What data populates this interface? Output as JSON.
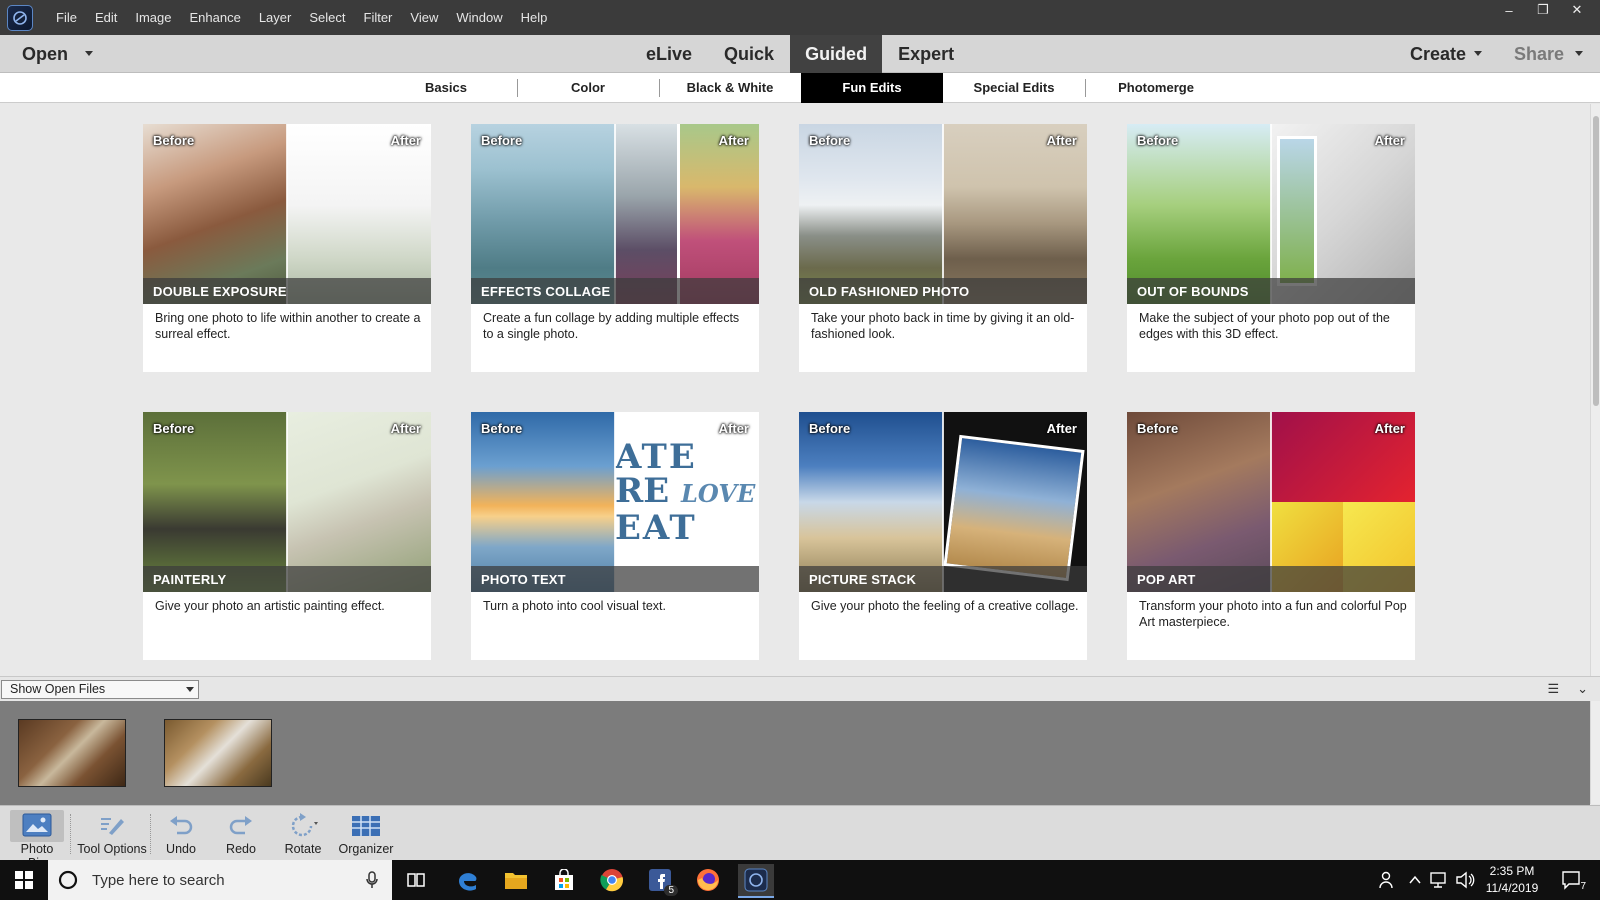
{
  "menu": [
    "File",
    "Edit",
    "Image",
    "Enhance",
    "Layer",
    "Select",
    "Filter",
    "View",
    "Window",
    "Help"
  ],
  "window_controls": {
    "minimize": "–",
    "restore": "❐",
    "close": "✕"
  },
  "modebar": {
    "open_label": "Open",
    "modes": [
      "eLive",
      "Quick",
      "Guided",
      "Expert"
    ],
    "active_mode": "Guided",
    "create_label": "Create",
    "share_label": "Share"
  },
  "tabs": [
    "Basics",
    "Color",
    "Black & White",
    "Fun Edits",
    "Special Edits",
    "Photomerge"
  ],
  "active_tab": "Fun Edits",
  "before_label": "Before",
  "after_label": "After",
  "cards": [
    {
      "title": "DOUBLE EXPOSURE",
      "desc": "Bring one photo to life within another to create a surreal effect."
    },
    {
      "title": "EFFECTS COLLAGE",
      "desc": "Create a fun collage by adding multiple effects to a single photo."
    },
    {
      "title": "OLD FASHIONED PHOTO",
      "desc": "Take your photo back in time by giving it an old-fashioned look."
    },
    {
      "title": "OUT OF BOUNDS",
      "desc": "Make the subject of your photo pop out of the edges with this 3D effect."
    },
    {
      "title": "PAINTERLY",
      "desc": "Give your photo an artistic painting effect."
    },
    {
      "title": "PHOTO TEXT",
      "desc": "Turn a photo into cool visual text."
    },
    {
      "title": "PICTURE STACK",
      "desc": "Give your photo the feeling of a creative collage."
    },
    {
      "title": "POP ART",
      "desc": "Transform your photo into a fun and colorful Pop Art masterpiece."
    }
  ],
  "photo_text_overlay": {
    "line1": "ATE",
    "line2": "RE",
    "love": "LOVE",
    "line3": "EAT"
  },
  "photo_bin": {
    "select_value": "Show Open Files"
  },
  "toolbar": {
    "photo_bin": "Photo Bin",
    "tool_options": "Tool Options",
    "undo": "Undo",
    "redo": "Redo",
    "rotate": "Rotate",
    "organizer": "Organizer"
  },
  "taskbar": {
    "search_placeholder": "Type here to search",
    "facebook_badge": "5",
    "time": "2:35 PM",
    "date": "11/4/2019",
    "notifications": "7"
  }
}
